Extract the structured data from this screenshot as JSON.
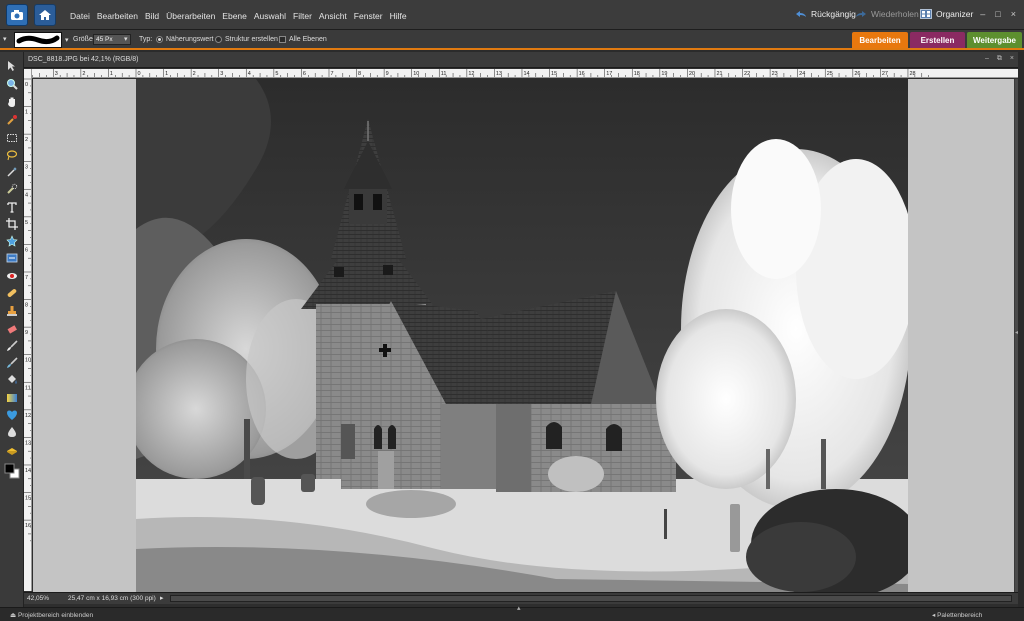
{
  "menubar": {
    "items": [
      "Datei",
      "Bearbeiten",
      "Bild",
      "Überarbeiten",
      "Ebene",
      "Auswahl",
      "Filter",
      "Ansicht",
      "Fenster",
      "Hilfe"
    ],
    "undo_label": "Rückgängig",
    "redo_label": "Wiederholen",
    "organizer_label": "Organizer",
    "window_controls": [
      "–",
      "□",
      "×"
    ]
  },
  "options": {
    "size_label": "Größe:",
    "size_value": "45 Px",
    "type_label": "Typ:",
    "radio1_label": "Näherungswert",
    "radio2_label": "Struktur erstellen",
    "check_label": "Alle Ebenen",
    "tabs": [
      {
        "label": "Bearbeiten",
        "color": "#e8780e"
      },
      {
        "label": "Erstellen",
        "color": "#8a2a62"
      },
      {
        "label": "Weitergabe",
        "color": "#5d8f2f"
      }
    ]
  },
  "document": {
    "title": "DSC_8818.JPG bei 42,1% (RGB/8)",
    "ruler_h": [
      "0",
      "1",
      "2",
      "3",
      "4",
      "5",
      "6",
      "7",
      "8",
      "9",
      "10",
      "11",
      "12",
      "13",
      "14",
      "15",
      "16",
      "17",
      "18",
      "19",
      "20",
      "21",
      "22",
      "23",
      "24",
      "25",
      "26",
      "27",
      "28"
    ],
    "ruler_h_neg": [
      "4",
      "3",
      "2",
      "1"
    ],
    "ruler_v": [
      "0",
      "1",
      "2",
      "3",
      "4",
      "5",
      "6",
      "7",
      "8",
      "9",
      "10",
      "11",
      "12",
      "13",
      "14",
      "15",
      "16"
    ],
    "zoom": "42,05%",
    "dimensions": "25,47 cm x 16,93 cm (300 ppi)"
  },
  "bottom": {
    "left_label": "Projektbereich einblenden",
    "right_label": "Palettenbereich"
  },
  "tools": [
    "move-tool",
    "zoom-tool",
    "hand-tool",
    "eyedropper-tool",
    "marquee-tool",
    "lasso-tool",
    "magic-wand-tool",
    "quick-selection-tool",
    "type-tool",
    "crop-tool",
    "cookie-cutter-tool",
    "recompose-tool",
    "red-eye-tool",
    "spot-healing-tool",
    "clone-stamp-tool",
    "eraser-tool",
    "brush-tool",
    "smart-brush-tool",
    "paint-bucket-tool",
    "gradient-tool",
    "custom-shape-tool",
    "blur-tool",
    "sponge-tool",
    "color-swatches"
  ]
}
